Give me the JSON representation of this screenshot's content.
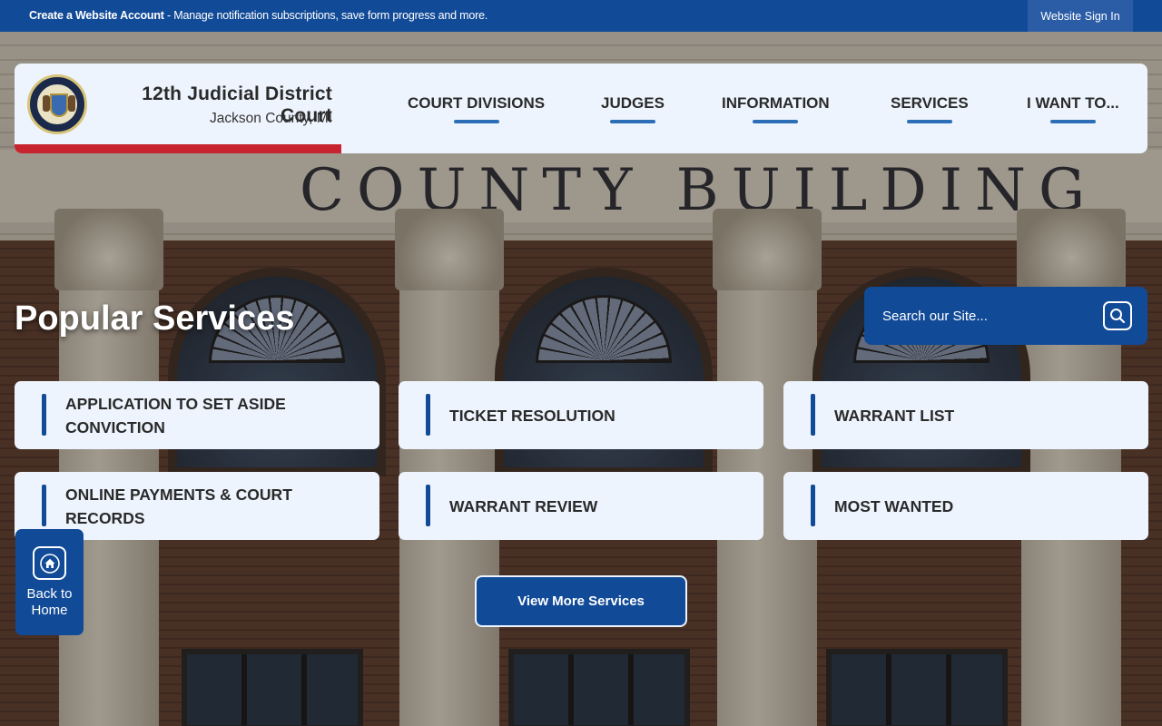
{
  "topbar": {
    "notice_bold": "Create a Website Account",
    "notice_rest": " - Manage notification subscriptions, save form progress and more.",
    "signin_label": "Website Sign In"
  },
  "header": {
    "court_name": "12th Judicial District Court",
    "court_location": "Jackson County, MI",
    "nav": [
      {
        "label": "COURT DIVISIONS"
      },
      {
        "label": "JUDGES"
      },
      {
        "label": "INFORMATION"
      },
      {
        "label": "SERVICES"
      },
      {
        "label": "I WANT TO..."
      }
    ]
  },
  "background": {
    "carved_text": "COUNTY BUILDING"
  },
  "services": {
    "title": "Popular Services",
    "search_placeholder": "Search our Site...",
    "tiles": [
      {
        "label": "APPLICATION TO SET ASIDE CONVICTION"
      },
      {
        "label": "TICKET RESOLUTION"
      },
      {
        "label": "WARRANT LIST"
      },
      {
        "label": "ONLINE PAYMENTS & COURT RECORDS"
      },
      {
        "label": "WARRANT REVIEW"
      },
      {
        "label": "MOST WANTED"
      }
    ],
    "more_label": "View More Services"
  },
  "back_home": {
    "label": "Back to Home"
  },
  "colors": {
    "primary_blue": "#114a97",
    "accent_red": "#c8242f",
    "card_bg": "#eef4fd",
    "nav_underline": "#2c6fb6"
  },
  "icons": {
    "search": "magnifier-icon",
    "home": "home-icon"
  }
}
